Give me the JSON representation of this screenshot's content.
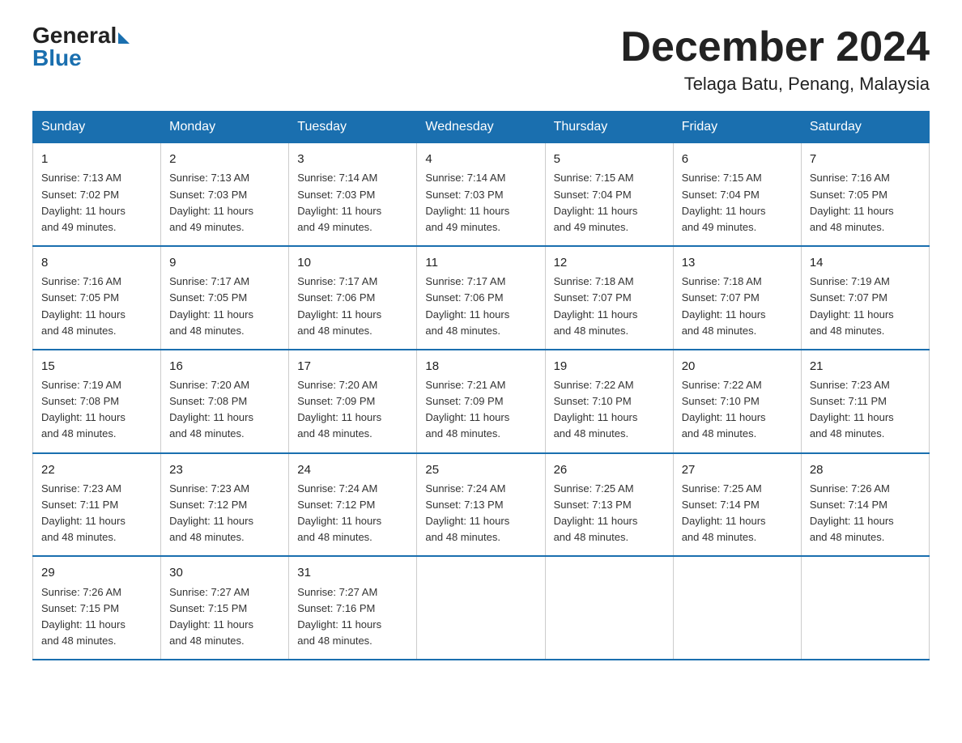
{
  "header": {
    "logo_general": "General",
    "logo_blue": "Blue",
    "month_year": "December 2024",
    "location": "Telaga Batu, Penang, Malaysia"
  },
  "days_of_week": [
    "Sunday",
    "Monday",
    "Tuesday",
    "Wednesday",
    "Thursday",
    "Friday",
    "Saturday"
  ],
  "weeks": [
    [
      {
        "day": "1",
        "info": "Sunrise: 7:13 AM\nSunset: 7:02 PM\nDaylight: 11 hours\nand 49 minutes."
      },
      {
        "day": "2",
        "info": "Sunrise: 7:13 AM\nSunset: 7:03 PM\nDaylight: 11 hours\nand 49 minutes."
      },
      {
        "day": "3",
        "info": "Sunrise: 7:14 AM\nSunset: 7:03 PM\nDaylight: 11 hours\nand 49 minutes."
      },
      {
        "day": "4",
        "info": "Sunrise: 7:14 AM\nSunset: 7:03 PM\nDaylight: 11 hours\nand 49 minutes."
      },
      {
        "day": "5",
        "info": "Sunrise: 7:15 AM\nSunset: 7:04 PM\nDaylight: 11 hours\nand 49 minutes."
      },
      {
        "day": "6",
        "info": "Sunrise: 7:15 AM\nSunset: 7:04 PM\nDaylight: 11 hours\nand 49 minutes."
      },
      {
        "day": "7",
        "info": "Sunrise: 7:16 AM\nSunset: 7:05 PM\nDaylight: 11 hours\nand 48 minutes."
      }
    ],
    [
      {
        "day": "8",
        "info": "Sunrise: 7:16 AM\nSunset: 7:05 PM\nDaylight: 11 hours\nand 48 minutes."
      },
      {
        "day": "9",
        "info": "Sunrise: 7:17 AM\nSunset: 7:05 PM\nDaylight: 11 hours\nand 48 minutes."
      },
      {
        "day": "10",
        "info": "Sunrise: 7:17 AM\nSunset: 7:06 PM\nDaylight: 11 hours\nand 48 minutes."
      },
      {
        "day": "11",
        "info": "Sunrise: 7:17 AM\nSunset: 7:06 PM\nDaylight: 11 hours\nand 48 minutes."
      },
      {
        "day": "12",
        "info": "Sunrise: 7:18 AM\nSunset: 7:07 PM\nDaylight: 11 hours\nand 48 minutes."
      },
      {
        "day": "13",
        "info": "Sunrise: 7:18 AM\nSunset: 7:07 PM\nDaylight: 11 hours\nand 48 minutes."
      },
      {
        "day": "14",
        "info": "Sunrise: 7:19 AM\nSunset: 7:07 PM\nDaylight: 11 hours\nand 48 minutes."
      }
    ],
    [
      {
        "day": "15",
        "info": "Sunrise: 7:19 AM\nSunset: 7:08 PM\nDaylight: 11 hours\nand 48 minutes."
      },
      {
        "day": "16",
        "info": "Sunrise: 7:20 AM\nSunset: 7:08 PM\nDaylight: 11 hours\nand 48 minutes."
      },
      {
        "day": "17",
        "info": "Sunrise: 7:20 AM\nSunset: 7:09 PM\nDaylight: 11 hours\nand 48 minutes."
      },
      {
        "day": "18",
        "info": "Sunrise: 7:21 AM\nSunset: 7:09 PM\nDaylight: 11 hours\nand 48 minutes."
      },
      {
        "day": "19",
        "info": "Sunrise: 7:22 AM\nSunset: 7:10 PM\nDaylight: 11 hours\nand 48 minutes."
      },
      {
        "day": "20",
        "info": "Sunrise: 7:22 AM\nSunset: 7:10 PM\nDaylight: 11 hours\nand 48 minutes."
      },
      {
        "day": "21",
        "info": "Sunrise: 7:23 AM\nSunset: 7:11 PM\nDaylight: 11 hours\nand 48 minutes."
      }
    ],
    [
      {
        "day": "22",
        "info": "Sunrise: 7:23 AM\nSunset: 7:11 PM\nDaylight: 11 hours\nand 48 minutes."
      },
      {
        "day": "23",
        "info": "Sunrise: 7:23 AM\nSunset: 7:12 PM\nDaylight: 11 hours\nand 48 minutes."
      },
      {
        "day": "24",
        "info": "Sunrise: 7:24 AM\nSunset: 7:12 PM\nDaylight: 11 hours\nand 48 minutes."
      },
      {
        "day": "25",
        "info": "Sunrise: 7:24 AM\nSunset: 7:13 PM\nDaylight: 11 hours\nand 48 minutes."
      },
      {
        "day": "26",
        "info": "Sunrise: 7:25 AM\nSunset: 7:13 PM\nDaylight: 11 hours\nand 48 minutes."
      },
      {
        "day": "27",
        "info": "Sunrise: 7:25 AM\nSunset: 7:14 PM\nDaylight: 11 hours\nand 48 minutes."
      },
      {
        "day": "28",
        "info": "Sunrise: 7:26 AM\nSunset: 7:14 PM\nDaylight: 11 hours\nand 48 minutes."
      }
    ],
    [
      {
        "day": "29",
        "info": "Sunrise: 7:26 AM\nSunset: 7:15 PM\nDaylight: 11 hours\nand 48 minutes."
      },
      {
        "day": "30",
        "info": "Sunrise: 7:27 AM\nSunset: 7:15 PM\nDaylight: 11 hours\nand 48 minutes."
      },
      {
        "day": "31",
        "info": "Sunrise: 7:27 AM\nSunset: 7:16 PM\nDaylight: 11 hours\nand 48 minutes."
      },
      {
        "day": "",
        "info": ""
      },
      {
        "day": "",
        "info": ""
      },
      {
        "day": "",
        "info": ""
      },
      {
        "day": "",
        "info": ""
      }
    ]
  ]
}
